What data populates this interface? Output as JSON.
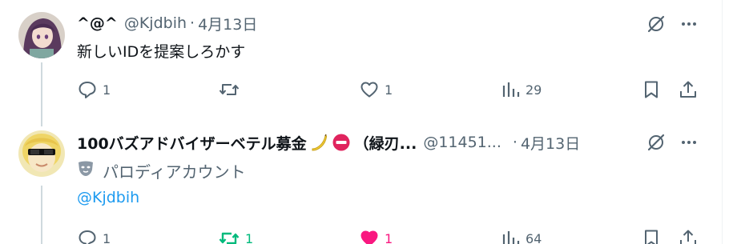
{
  "tweet1": {
    "display_name": "^@^",
    "handle": "@Kjdbih",
    "dot": "·",
    "date": "4月13日",
    "text": "新しいIDを提案しろかす",
    "avatar_icon": "anime-girl-avatar",
    "actions": {
      "reply_count": "1",
      "retweet_count": "",
      "like_count": "1",
      "views_count": "29"
    }
  },
  "tweet2": {
    "display_name": "100バズアドバイザーベテル募金",
    "display_name_suffix": "（緑刃...",
    "display_name_emojis": [
      "banana-emoji",
      "no-entry-emoji"
    ],
    "handle": "@11451...",
    "dot": "·",
    "date": "4月13日",
    "parody_label": "パロディアカウント",
    "parody_icon": "theater-mask-icon",
    "reply_to": "@Kjdbih",
    "avatar_icon": "sunglasses-character-avatar",
    "actions": {
      "reply_count": "1",
      "retweet_count": "1",
      "like_count": "1",
      "views_count": "64",
      "retweeted": true,
      "liked": true
    }
  },
  "colors": {
    "text_primary": "#0f1419",
    "text_secondary": "#536471",
    "link": "#1d9bf0",
    "retweet_active": "#00ba7c",
    "like_active": "#f91880",
    "thread_line": "#cfd9de"
  }
}
